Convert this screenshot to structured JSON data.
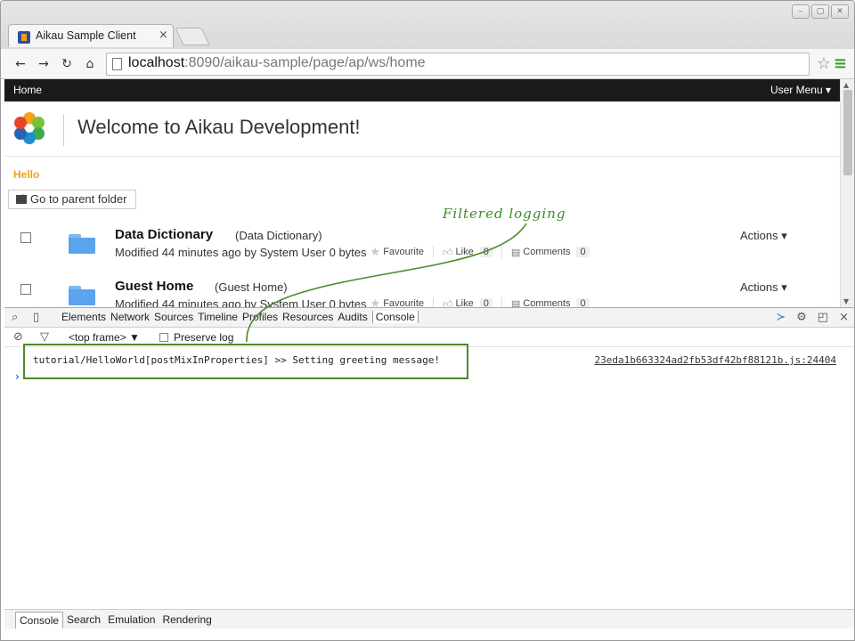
{
  "browser": {
    "tab_title": "Aikau Sample Client",
    "tab_close": "×",
    "url_host": "localhost",
    "url_path": ":8090/aikau-sample/page/ap/ws/home",
    "window_controls": [
      "–",
      "▢",
      "✕"
    ]
  },
  "appbar": {
    "home_label": "Home",
    "user_menu_label": "User Menu ▾"
  },
  "header": {
    "title": "Welcome to Aikau Development!"
  },
  "page": {
    "hello_text": "Hello",
    "parent_button": "Go to parent folder"
  },
  "documents": [
    {
      "name": "Data Dictionary",
      "title": "(Data Dictionary)",
      "meta": "Modified 44 minutes ago by System User 0 bytes",
      "favourite": "Favourite",
      "like": "Like",
      "like_count": "0",
      "comments": "Comments",
      "comments_count": "0",
      "actions": "Actions ▾"
    },
    {
      "name": "Guest Home",
      "title": "(Guest Home)",
      "meta": "Modified 44 minutes ago by System User 0 bytes",
      "favourite": "Favourite",
      "like": "Like",
      "like_count": "0",
      "comments": "Comments",
      "comments_count": "0",
      "actions": "Actions ▾"
    }
  ],
  "devtools": {
    "tabs": [
      "Elements",
      "Network",
      "Sources",
      "Timeline",
      "Profiles",
      "Resources",
      "Audits",
      "Console"
    ],
    "active_tab": "Console",
    "frame_select": "<top frame>  ▼",
    "preserve_log": "Preserve log",
    "log_message": "tutorial/HelloWorld[postMixInProperties] >> Setting greeting message!",
    "log_source": "23eda1b663324ad2fb53df42bf88121b.js:24404",
    "prompt": "›",
    "drawer_tabs": [
      "Console",
      "Search",
      "Emulation",
      "Rendering"
    ],
    "drawer_active": "Console"
  },
  "annotation": {
    "label": "Filtered logging",
    "color": "#4a8a2a"
  },
  "colors": {
    "accent_orange": "#e9a11b",
    "appbar_bg": "#1a1a1a",
    "folder_blue": "#5aa4ee"
  }
}
